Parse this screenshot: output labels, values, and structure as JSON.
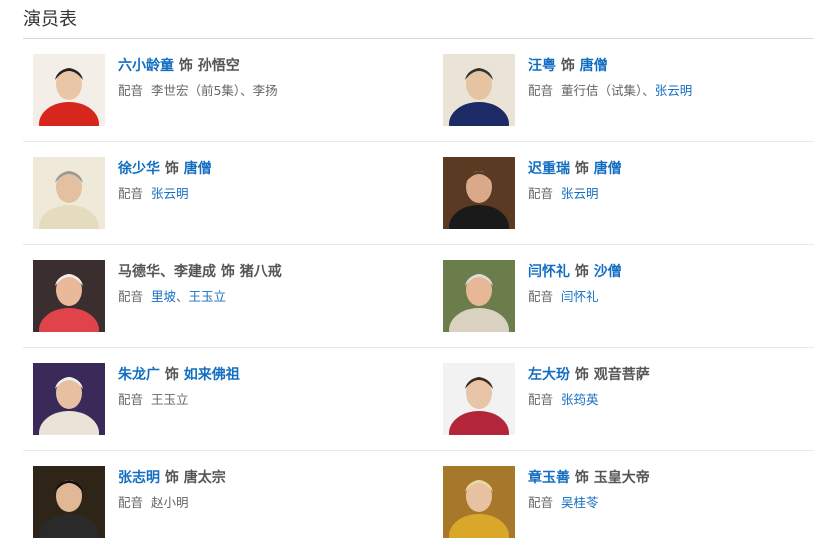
{
  "section_title": "演员表",
  "colors": {
    "link": "#136ec2",
    "text": "#555555",
    "divider": "#e8e8e8"
  },
  "voice_label": "配音",
  "role_sep": "饰",
  "cast": [
    {
      "actor": "六小龄童",
      "actor_link": true,
      "role": "孙悟空",
      "role_link": false,
      "voices": [
        {
          "text": "李世宏（前5集）、李扬",
          "link": false
        }
      ]
    },
    {
      "actor": "汪粤",
      "actor_link": true,
      "role": "唐僧",
      "role_link": true,
      "voices": [
        {
          "text": "董行佶（试集）、",
          "link": false
        },
        {
          "text": "张云明",
          "link": true
        }
      ]
    },
    {
      "actor": "徐少华",
      "actor_link": true,
      "role": "唐僧",
      "role_link": true,
      "voices": [
        {
          "text": "张云明",
          "link": true
        }
      ]
    },
    {
      "actor": "迟重瑞",
      "actor_link": true,
      "role": "唐僧",
      "role_link": true,
      "voices": [
        {
          "text": "张云明",
          "link": true
        }
      ]
    },
    {
      "actor": "马德华、李建成",
      "actor_link": false,
      "role": "猪八戒",
      "role_link": false,
      "voices": [
        {
          "text": "里坡",
          "link": true
        },
        {
          "text": "、",
          "link": false
        },
        {
          "text": "王玉立",
          "link": true
        }
      ]
    },
    {
      "actor": "闫怀礼",
      "actor_link": true,
      "role": "沙僧",
      "role_link": true,
      "voices": [
        {
          "text": "闫怀礼",
          "link": true
        }
      ]
    },
    {
      "actor": "朱龙广",
      "actor_link": true,
      "role": "如来佛祖",
      "role_link": true,
      "voices": [
        {
          "text": "王玉立",
          "link": false
        }
      ]
    },
    {
      "actor": "左大玢",
      "actor_link": true,
      "role": "观音菩萨",
      "role_link": false,
      "voices": [
        {
          "text": "张筠英",
          "link": true
        }
      ]
    },
    {
      "actor": "张志明",
      "actor_link": true,
      "role": "唐太宗",
      "role_link": false,
      "voices": [
        {
          "text": "赵小明",
          "link": false
        }
      ]
    },
    {
      "actor": "章玉善",
      "actor_link": true,
      "role": "玉皇大帝",
      "role_link": false,
      "voices": [
        {
          "text": "吴桂苓",
          "link": true
        }
      ]
    }
  ]
}
